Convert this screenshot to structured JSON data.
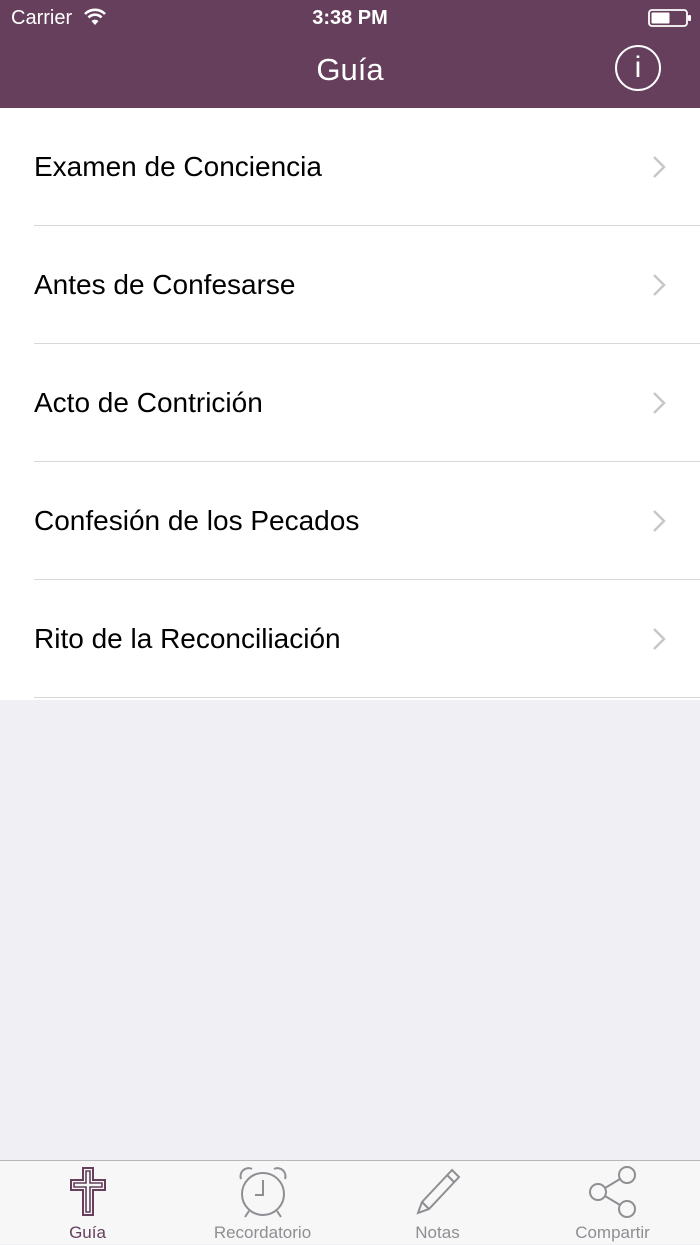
{
  "status_bar": {
    "carrier": "Carrier",
    "time": "3:38 PM"
  },
  "nav": {
    "title": "Guía",
    "info_label": "i"
  },
  "list": {
    "items": [
      {
        "label": "Examen de Conciencia"
      },
      {
        "label": "Antes de Confesarse"
      },
      {
        "label": "Acto de Contrición"
      },
      {
        "label": "Confesión de los Pecados"
      },
      {
        "label": "Rito de la Reconciliación"
      }
    ]
  },
  "tabbar": {
    "tabs": [
      {
        "label": "Guía",
        "icon": "cross-icon",
        "active": true
      },
      {
        "label": "Recordatorio",
        "icon": "alarm-clock-icon",
        "active": false
      },
      {
        "label": "Notas",
        "icon": "pencil-icon",
        "active": false
      },
      {
        "label": "Compartir",
        "icon": "share-icon",
        "active": false
      }
    ]
  },
  "colors": {
    "accent": "#653f5c",
    "inactive_tab": "#8e8e93",
    "background": "#efeff4"
  }
}
